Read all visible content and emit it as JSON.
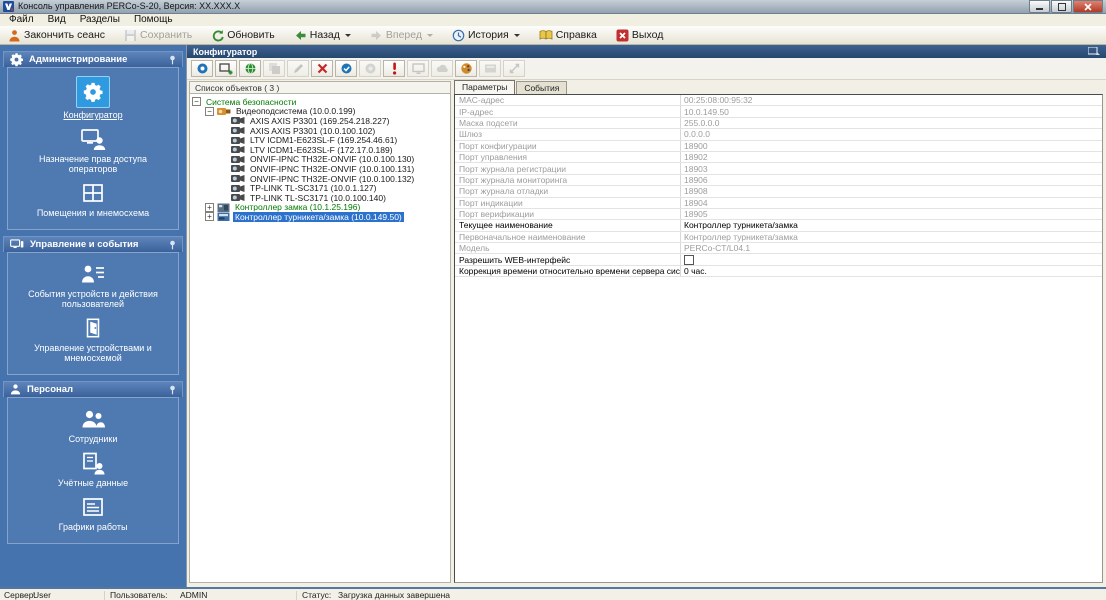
{
  "titlebar": {
    "title": "Консоль управления PERCo-S-20, Версия: XX.XXX.X"
  },
  "menubar": {
    "items": [
      "Файл",
      "Вид",
      "Разделы",
      "Помощь"
    ]
  },
  "main_toolbar": {
    "buttons": [
      {
        "label": "Закончить сеанс",
        "icon": "end-session",
        "disabled": false,
        "dropdown": false
      },
      {
        "label": "Сохранить",
        "icon": "save",
        "disabled": true,
        "dropdown": false
      },
      {
        "label": "Обновить",
        "icon": "refresh",
        "disabled": false,
        "dropdown": false
      },
      {
        "label": "Назад",
        "icon": "back",
        "disabled": false,
        "dropdown": true
      },
      {
        "label": "Вперед",
        "icon": "forward",
        "disabled": true,
        "dropdown": true
      },
      {
        "label": "История",
        "icon": "history",
        "disabled": false,
        "dropdown": true
      },
      {
        "label": "Справка",
        "icon": "help",
        "disabled": false,
        "dropdown": false
      },
      {
        "label": "Выход",
        "icon": "exit",
        "disabled": false,
        "dropdown": false
      }
    ]
  },
  "sidebar": {
    "sections": [
      {
        "title": "Администрирование",
        "icon": "gear-section",
        "items": [
          {
            "label": "Конфигуратор",
            "icon": "configurator-gear",
            "selected": true
          },
          {
            "label": "Назначение прав доступа операторов",
            "icon": "operator-monitor",
            "selected": false
          },
          {
            "label": "Помещения и мнемосхема",
            "icon": "rooms-grid",
            "selected": false
          }
        ]
      },
      {
        "title": "Управление и события",
        "icon": "monitor-section",
        "items": [
          {
            "label": "События устройств и действия пользователей",
            "icon": "user-events",
            "selected": false
          },
          {
            "label": "Управление устройствами и мнемосхемой",
            "icon": "door",
            "selected": false
          }
        ]
      },
      {
        "title": "Персонал",
        "icon": "person-section",
        "items": [
          {
            "label": "Сотрудники",
            "icon": "people",
            "selected": false
          },
          {
            "label": "Учётные данные",
            "icon": "credentials",
            "selected": false
          },
          {
            "label": "Графики работы",
            "icon": "schedule",
            "selected": false
          }
        ]
      }
    ]
  },
  "panel": {
    "title": "Конфигуратор",
    "tree_header": "Список объектов ( 3 )",
    "toolbar": [
      {
        "name": "search-devices",
        "disabled": false
      },
      {
        "name": "add-device",
        "disabled": false
      },
      {
        "name": "web-interface",
        "disabled": false
      },
      {
        "name": "transfer",
        "disabled": true
      },
      {
        "name": "edit",
        "disabled": true
      },
      {
        "name": "delete",
        "disabled": false
      },
      {
        "name": "verify-device",
        "disabled": false
      },
      {
        "name": "restore",
        "disabled": true
      },
      {
        "name": "alarm-reset",
        "disabled": false
      },
      {
        "name": "monitoring",
        "disabled": true
      },
      {
        "name": "sync-config",
        "disabled": true
      },
      {
        "name": "video-settings",
        "disabled": false
      },
      {
        "name": "card-format",
        "disabled": true
      },
      {
        "name": "expand-view",
        "disabled": true
      }
    ],
    "tabs": [
      {
        "label": "Параметры",
        "active": true
      },
      {
        "label": "События",
        "active": false
      }
    ]
  },
  "tree": {
    "nodes": [
      {
        "label": "Система безопасности",
        "depth": 0,
        "expand": "minus",
        "icon": null,
        "green": true,
        "selected": false
      },
      {
        "label": "Видеоподсистема (10.0.0.199)",
        "depth": 1,
        "expand": "minus",
        "icon": "video-subsystem",
        "green": false,
        "selected": false
      },
      {
        "label": "AXIS AXIS P3301 (169.254.218.227)",
        "depth": 2,
        "expand": null,
        "icon": "camera",
        "green": false,
        "selected": false
      },
      {
        "label": "AXIS AXIS P3301 (10.0.100.102)",
        "depth": 2,
        "expand": null,
        "icon": "camera",
        "green": false,
        "selected": false
      },
      {
        "label": "LTV ICDM1-E623SL-F (169.254.46.61)",
        "depth": 2,
        "expand": null,
        "icon": "camera",
        "green": false,
        "selected": false
      },
      {
        "label": "LTV ICDM1-E623SL-F (172.17.0.189)",
        "depth": 2,
        "expand": null,
        "icon": "camera",
        "green": false,
        "selected": false
      },
      {
        "label": "ONVIF-IPNC TH32E-ONVIF (10.0.100.130)",
        "depth": 2,
        "expand": null,
        "icon": "camera",
        "green": false,
        "selected": false
      },
      {
        "label": "ONVIF-IPNC TH32E-ONVIF (10.0.100.131)",
        "depth": 2,
        "expand": null,
        "icon": "camera",
        "green": false,
        "selected": false
      },
      {
        "label": "ONVIF-IPNC TH32E-ONVIF (10.0.100.132)",
        "depth": 2,
        "expand": null,
        "icon": "camera",
        "green": false,
        "selected": false
      },
      {
        "label": "TP-LINK TL-SC3171 (10.0.1.127)",
        "depth": 2,
        "expand": null,
        "icon": "camera",
        "green": false,
        "selected": false
      },
      {
        "label": "TP-LINK TL-SC3171 (10.0.100.140)",
        "depth": 2,
        "expand": null,
        "icon": "camera",
        "green": false,
        "selected": false
      },
      {
        "label": "Контроллер замка (10.1.25.196)",
        "depth": 1,
        "expand": "plus",
        "icon": "lock-controller",
        "green": true,
        "selected": false
      },
      {
        "label": "Контроллер турникета/замка (10.0.149.50)",
        "depth": 1,
        "expand": "plus",
        "icon": "turnstile-controller",
        "green": false,
        "selected": true
      }
    ]
  },
  "properties": {
    "rows": [
      {
        "label": "MAC-адрес",
        "value": "00:25:08:00:95:32",
        "muted": true,
        "checkbox": false
      },
      {
        "label": "IP-адрес",
        "value": "10.0.149.50",
        "muted": true,
        "checkbox": false
      },
      {
        "label": "Маска подсети",
        "value": "255.0.0.0",
        "muted": true,
        "checkbox": false
      },
      {
        "label": "Шлюз",
        "value": "0.0.0.0",
        "muted": true,
        "checkbox": false
      },
      {
        "label": "Порт конфигурации",
        "value": "18900",
        "muted": true,
        "checkbox": false
      },
      {
        "label": "Порт управления",
        "value": "18902",
        "muted": true,
        "checkbox": false
      },
      {
        "label": "Порт журнала регистрации",
        "value": "18903",
        "muted": true,
        "checkbox": false
      },
      {
        "label": "Порт журнала мониторинга",
        "value": "18906",
        "muted": true,
        "checkbox": false
      },
      {
        "label": "Порт журнала отладки",
        "value": "18908",
        "muted": true,
        "checkbox": false
      },
      {
        "label": "Порт индикации",
        "value": "18904",
        "muted": true,
        "checkbox": false
      },
      {
        "label": "Порт верификации",
        "value": "18905",
        "muted": true,
        "checkbox": false
      },
      {
        "label": "Текущее наименование",
        "value": "Контроллер турникета/замка",
        "muted": false,
        "checkbox": false
      },
      {
        "label": "Первоначальное наименование",
        "value": "Контроллер турникета/замка",
        "muted": true,
        "checkbox": false
      },
      {
        "label": "Модель",
        "value": "PERCo-CT/L04.1",
        "muted": true,
        "checkbox": false
      },
      {
        "label": "Разрешить WEB-интерфейс",
        "value": "",
        "muted": false,
        "checkbox": true,
        "checked": false
      },
      {
        "label": "Коррекция времени относительно времени сервера системы",
        "value": "0 час.",
        "muted": false,
        "checkbox": false
      }
    ]
  },
  "statusbar": {
    "server_label": "Сервер:",
    "server_value": "User",
    "user_label": "Пользователь:",
    "user_value": "ADMIN",
    "status_label": "Статус:",
    "status_value": "Загрузка данных завершена"
  }
}
